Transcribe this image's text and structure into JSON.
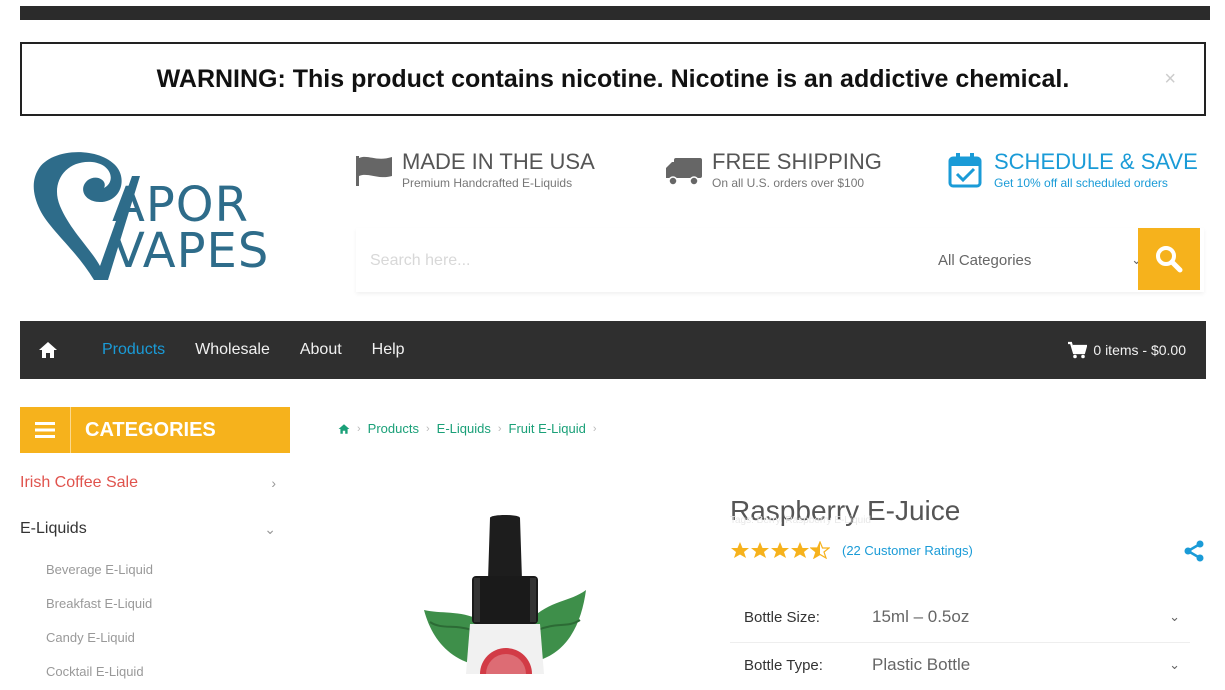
{
  "warning": {
    "text": "WARNING: This product contains nicotine. Nicotine is an addictive chemical.",
    "close": "×"
  },
  "logo": {
    "line1": "APOR",
    "line2": "VAPES"
  },
  "features": [
    {
      "title": "MADE IN THE USA",
      "subtitle": "Premium Handcrafted E-Liquids",
      "icon": "flag-icon"
    },
    {
      "title": "FREE SHIPPING",
      "subtitle": "On all U.S. orders over $100",
      "icon": "truck-icon"
    },
    {
      "title": "SCHEDULE & SAVE",
      "subtitle": "Get 10% off all scheduled orders",
      "icon": "calendar-icon"
    }
  ],
  "search": {
    "placeholder": "Search here...",
    "category": "All Categories"
  },
  "nav": {
    "items": [
      "Products",
      "Wholesale",
      "About",
      "Help"
    ],
    "active": "Products",
    "cart": "0 items - $0.00"
  },
  "categories": {
    "title": "CATEGORIES",
    "items": [
      {
        "label": "Irish Coffee Sale",
        "chevron": "›"
      },
      {
        "label": "E-Liquids",
        "chevron": "⌄"
      }
    ],
    "subitems": [
      "Beverage E-Liquid",
      "Breakfast E-Liquid",
      "Candy E-Liquid",
      "Cocktail E-Liquid"
    ]
  },
  "breadcrumb": [
    "Products",
    "E-Liquids",
    "Fruit E-Liquid"
  ],
  "product": {
    "title": "Raspberry E-Juice",
    "tags": "Tags: Berry, Raspberry E-Liquid",
    "rating": 4.5,
    "ratings_text": "(22 Customer Ratings)",
    "options": [
      {
        "label": "Bottle Size:",
        "value": "15ml – 0.5oz"
      },
      {
        "label": "Bottle Type:",
        "value": "Plastic Bottle"
      }
    ]
  },
  "colors": {
    "accent": "#f6b21c",
    "brand_blue": "#1a9bd7",
    "nav_bg": "#2f2f2f",
    "breadcrumb": "#1aa078",
    "sale": "#e0534d"
  }
}
